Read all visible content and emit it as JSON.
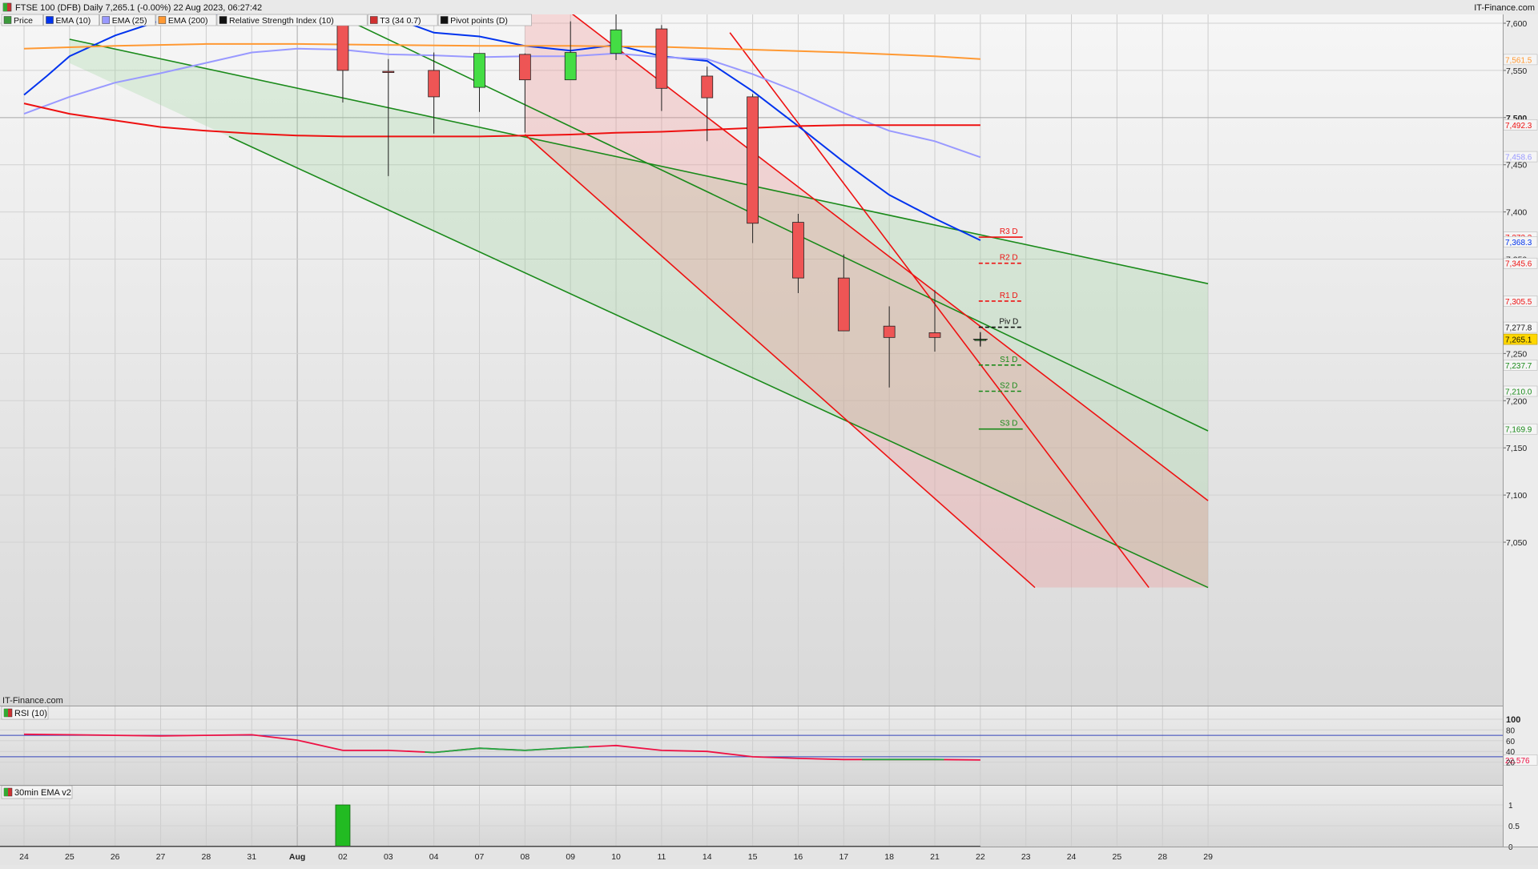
{
  "header": {
    "title": "FTSE 100 (DFB) Daily 7,265.1 (-0.00%) 22 Aug 2023, 06:27:42",
    "brand": "IT-Finance.com",
    "watermark": "IT-Finance.com"
  },
  "legend": [
    {
      "label": "Price",
      "color": "#3c9a3c"
    },
    {
      "label": "EMA (10)",
      "color": "#0033ee"
    },
    {
      "label": "EMA (25)",
      "color": "#9999ff"
    },
    {
      "label": "EMA (200)",
      "color": "#ff9933"
    },
    {
      "label": "Relative Strength Index (10)",
      "color": "#111111"
    },
    {
      "label": "T3 (34 0.7)",
      "color": "#d03030"
    },
    {
      "label": "Pivot points (D)",
      "color": "#111111"
    }
  ],
  "colors": {
    "up": "#44dd44",
    "down": "#ee5555",
    "ema10": "#0033ee",
    "ema25": "#9999ff",
    "ema200": "#ff9933",
    "t3": "#ee1111",
    "channel_green": "#1a8a1a",
    "channel_red": "#ee1111",
    "price_tag": "#ffd700"
  },
  "chart_data": {
    "type": "candlestick",
    "title": "FTSE 100 (DFB) Daily 7,265.1 (-0.00%) 22 Aug 2023, 06:27:42",
    "ylim": [
      7000,
      7625
    ],
    "yticks": [
      {
        "value": 7050,
        "label": "7,050",
        "bold": false
      },
      {
        "value": 7100,
        "label": "7,100",
        "bold": false
      },
      {
        "value": 7150,
        "label": "7,150",
        "bold": false
      },
      {
        "value": 7200,
        "label": "7,200",
        "bold": false
      },
      {
        "value": 7250,
        "label": "7,250",
        "bold": false
      },
      {
        "value": 7350,
        "label": "7,350",
        "bold": false
      },
      {
        "value": 7400,
        "label": "7,400",
        "bold": false
      },
      {
        "value": 7450,
        "label": "7,450",
        "bold": false
      },
      {
        "value": 7500,
        "label": "7,500",
        "bold": true
      },
      {
        "value": 7550,
        "label": "7,550",
        "bold": false
      },
      {
        "value": 7600,
        "label": "7,600",
        "bold": false
      }
    ],
    "x_dates": [
      "24",
      "25",
      "26",
      "27",
      "28",
      "31",
      "Aug",
      "02",
      "03",
      "04",
      "07",
      "08",
      "09",
      "10",
      "11",
      "14",
      "15",
      "16",
      "17",
      "18",
      "21",
      "22",
      "23",
      "24",
      "25",
      "28",
      "29"
    ],
    "x_bold": [
      "Aug"
    ],
    "candles": [
      {
        "i": 7,
        "open": 7600,
        "high": 7625,
        "low": 7516,
        "close": 7550
      },
      {
        "i": 8,
        "open": 7549,
        "high": 7562,
        "low": 7438,
        "close": 7548
      },
      {
        "i": 9,
        "open": 7550,
        "high": 7569,
        "low": 7483,
        "close": 7522
      },
      {
        "i": 10,
        "open": 7532,
        "high": 7568,
        "low": 7506,
        "close": 7568
      },
      {
        "i": 11,
        "open": 7567,
        "high": 7568,
        "low": 7484,
        "close": 7540
      },
      {
        "i": 12,
        "open": 7540,
        "high": 7602,
        "low": 7540,
        "close": 7569
      },
      {
        "i": 13,
        "open": 7568,
        "high": 7610,
        "low": 7561,
        "close": 7593
      },
      {
        "i": 14,
        "open": 7594,
        "high": 7598,
        "low": 7507,
        "close": 7531
      },
      {
        "i": 15,
        "open": 7544,
        "high": 7554,
        "low": 7475,
        "close": 7521
      },
      {
        "i": 16,
        "open": 7522,
        "high": 7525,
        "low": 7367,
        "close": 7388
      },
      {
        "i": 17,
        "open": 7389,
        "high": 7398,
        "low": 7314,
        "close": 7330
      },
      {
        "i": 18,
        "open": 7330,
        "high": 7355,
        "low": 7274,
        "close": 7274
      },
      {
        "i": 19,
        "open": 7279,
        "high": 7300,
        "low": 7214,
        "close": 7267
      },
      {
        "i": 20,
        "open": 7272,
        "high": 7317,
        "low": 7252,
        "close": 7267
      },
      {
        "i": 21,
        "open": 7265,
        "high": 7270,
        "low": 7259,
        "close": 7265
      }
    ],
    "series": [
      {
        "name": "EMA (10)",
        "color": "#0033ee",
        "points": [
          [
            0,
            7524
          ],
          [
            0.5,
            7544
          ],
          [
            1,
            7565
          ],
          [
            2,
            7587
          ],
          [
            3,
            7603
          ],
          [
            7,
            7625
          ],
          [
            9,
            7590
          ],
          [
            10,
            7586
          ],
          [
            11,
            7576
          ],
          [
            12,
            7571
          ],
          [
            13,
            7577
          ],
          [
            14,
            7565
          ],
          [
            15,
            7560
          ],
          [
            16,
            7528
          ],
          [
            17,
            7491
          ],
          [
            18,
            7453
          ],
          [
            19,
            7418
          ],
          [
            20,
            7393
          ],
          [
            21,
            7370
          ]
        ]
      },
      {
        "name": "EMA (25)",
        "color": "#9999ff",
        "points": [
          [
            0,
            7504
          ],
          [
            1,
            7522
          ],
          [
            2,
            7537
          ],
          [
            3,
            7547
          ],
          [
            4,
            7558
          ],
          [
            5,
            7569
          ],
          [
            6,
            7573
          ],
          [
            7,
            7572
          ],
          [
            8,
            7567
          ],
          [
            9,
            7566
          ],
          [
            10,
            7564
          ],
          [
            11,
            7565
          ],
          [
            12,
            7565
          ],
          [
            13,
            7568
          ],
          [
            14,
            7564
          ],
          [
            15,
            7562
          ],
          [
            16,
            7546
          ],
          [
            17,
            7527
          ],
          [
            18,
            7505
          ],
          [
            19,
            7486
          ],
          [
            20,
            7475
          ],
          [
            21,
            7458
          ]
        ]
      },
      {
        "name": "EMA (200)",
        "color": "#ff9933",
        "points": [
          [
            0,
            7573
          ],
          [
            2,
            7576
          ],
          [
            4,
            7578
          ],
          [
            6,
            7578
          ],
          [
            8,
            7577
          ],
          [
            10,
            7576
          ],
          [
            12,
            7576
          ],
          [
            14,
            7575
          ],
          [
            16,
            7572
          ],
          [
            18,
            7569
          ],
          [
            20,
            7565
          ],
          [
            21,
            7562
          ]
        ]
      },
      {
        "name": "T3 (34 0.7)",
        "color": "#ee1111",
        "points": [
          [
            0,
            7515
          ],
          [
            1,
            7504
          ],
          [
            2,
            7497
          ],
          [
            3,
            7490
          ],
          [
            4,
            7486
          ],
          [
            5,
            7483
          ],
          [
            6,
            7481
          ],
          [
            7,
            7480
          ],
          [
            8,
            7480
          ],
          [
            9,
            7480
          ],
          [
            10,
            7480
          ],
          [
            11,
            7481
          ],
          [
            12,
            7482
          ],
          [
            13,
            7484
          ],
          [
            14,
            7485
          ],
          [
            15,
            7487
          ],
          [
            16,
            7489
          ],
          [
            17,
            7491
          ],
          [
            18,
            7492
          ],
          [
            19,
            7492
          ],
          [
            20,
            7492
          ],
          [
            21,
            7492
          ]
        ]
      }
    ],
    "channels": [
      {
        "color": "#1a8a1a",
        "points": [
          [
            1,
            7583
          ],
          [
            26,
            7324
          ]
        ]
      },
      {
        "color": "#1a8a1a",
        "points": [
          [
            6.6,
            7615
          ],
          [
            26,
            7168
          ]
        ]
      },
      {
        "color": "#1a8a1a",
        "points": [
          [
            4.5,
            7480
          ],
          [
            26,
            7002
          ]
        ]
      },
      {
        "color": "#ee1111",
        "points": [
          [
            11,
            7482
          ],
          [
            22.2,
            7002
          ]
        ]
      },
      {
        "color": "#ee1111",
        "points": [
          [
            11.9,
            7615
          ],
          [
            26,
            7094
          ]
        ]
      },
      {
        "color": "#ee1111",
        "points": [
          [
            15.5,
            7590
          ],
          [
            24.7,
            7002
          ]
        ]
      }
    ],
    "pivots": [
      {
        "label": "R3 D",
        "value": 7373.3,
        "color": "#ee1111",
        "dashed": false
      },
      {
        "label": "R2 D",
        "value": 7345.6,
        "color": "#ee1111",
        "dashed": true
      },
      {
        "label": "R1 D",
        "value": 7305.5,
        "color": "#ee1111",
        "dashed": true
      },
      {
        "label": "Piv D",
        "value": 7277.8,
        "color": "#111111",
        "dashed": true
      },
      {
        "label": "S1 D",
        "value": 7237.7,
        "color": "#1a8a1a",
        "dashed": true
      },
      {
        "label": "S2 D",
        "value": 7210.0,
        "color": "#1a8a1a",
        "dashed": true
      },
      {
        "label": "S3 D",
        "value": 7169.9,
        "color": "#1a8a1a",
        "dashed": false
      }
    ],
    "value_tags": [
      {
        "label": "7,561.5",
        "value": 7561.5,
        "color": "#ff9933"
      },
      {
        "label": "7,492.3",
        "value": 7492.3,
        "color": "#ee1111"
      },
      {
        "label": "7,458.6",
        "value": 7458.6,
        "color": "#9999ff"
      },
      {
        "label": "7,373.3",
        "value": 7373.3,
        "color": "#ee1111"
      },
      {
        "label": "7,368.3",
        "value": 7368.3,
        "color": "#0033ee"
      },
      {
        "label": "7,345.6",
        "value": 7345.6,
        "color": "#ee1111"
      },
      {
        "label": "7,305.5",
        "value": 7305.5,
        "color": "#ee1111"
      },
      {
        "label": "7,277.8",
        "value": 7277.8,
        "color": "#111111"
      },
      {
        "label": "7,265.1",
        "value": 7265.1,
        "color": "#111111",
        "highlight": true
      },
      {
        "label": "7,237.7",
        "value": 7237.7,
        "color": "#1a8a1a"
      },
      {
        "label": "7,210.0",
        "value": 7210.0,
        "color": "#1a8a1a"
      },
      {
        "label": "7,169.9",
        "value": 7169.9,
        "color": "#1a8a1a"
      }
    ],
    "rsi": {
      "legend": "RSI (10)",
      "ylim": [
        0,
        100
      ],
      "ticks": [
        {
          "value": 100,
          "label": "100",
          "bold": true
        },
        {
          "value": 80,
          "label": "80",
          "bold": false
        },
        {
          "value": 60,
          "label": "60",
          "bold": false
        },
        {
          "value": 40,
          "label": "40",
          "bold": false
        },
        {
          "value": 20,
          "label": "20",
          "bold": false
        }
      ],
      "levels": [
        70,
        30
      ],
      "last_label": "22.576",
      "points": [
        [
          0,
          72
        ],
        [
          1,
          71
        ],
        [
          2,
          70
        ],
        [
          3,
          69
        ],
        [
          4,
          70
        ],
        [
          5,
          71
        ],
        [
          6,
          61
        ],
        [
          7,
          42
        ],
        [
          8,
          42
        ],
        [
          9,
          38
        ],
        [
          10,
          46
        ],
        [
          11,
          42
        ],
        [
          12,
          47
        ],
        [
          13,
          51
        ],
        [
          14,
          42
        ],
        [
          15,
          40
        ],
        [
          16,
          30
        ],
        [
          17,
          27
        ],
        [
          18,
          25
        ],
        [
          19,
          25
        ],
        [
          20,
          25
        ],
        [
          21,
          24
        ]
      ],
      "up_segments": [
        [
          8.8,
          12.4
        ],
        [
          18.4,
          20.2
        ]
      ]
    },
    "ema30": {
      "legend": "30min EMA v2",
      "ylim": [
        0,
        1.1
      ],
      "ticks": [
        {
          "value": 1,
          "label": "1"
        },
        {
          "value": 0.5,
          "label": "0.5"
        },
        {
          "value": 0,
          "label": "0"
        }
      ],
      "bars": [
        {
          "i": 7,
          "value": 1
        }
      ]
    },
    "crosshair": {
      "i": 21,
      "value": 7265
    }
  }
}
